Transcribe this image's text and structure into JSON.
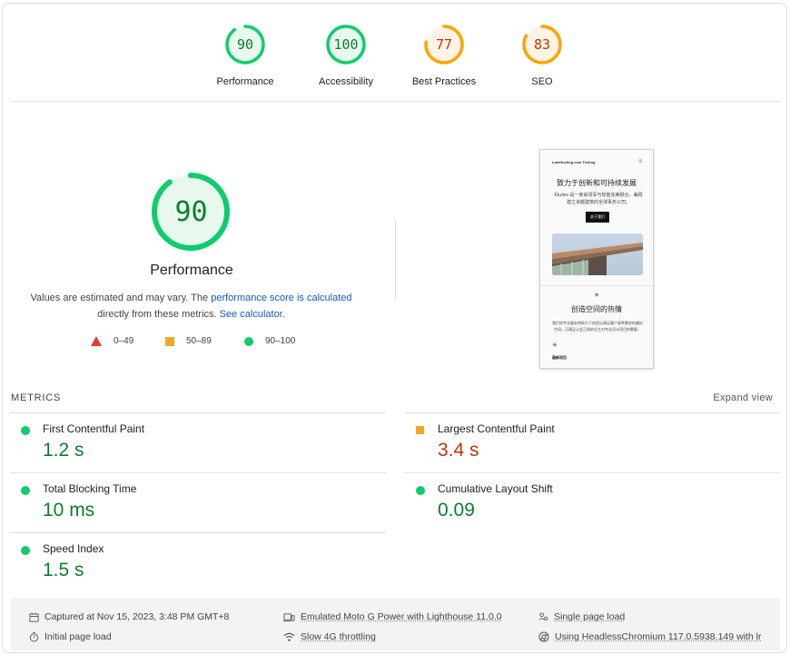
{
  "gauges": [
    {
      "score": "90",
      "label": "Performance",
      "color": "#0cce6b",
      "text_color": "#0a7f2e",
      "bg": "#e8f8ee"
    },
    {
      "score": "100",
      "label": "Accessibility",
      "color": "#0cce6b",
      "text_color": "#0a7f2e",
      "bg": "#e8f8ee"
    },
    {
      "score": "77",
      "label": "Best Practices",
      "color": "#ffa400",
      "text_color": "#c33300",
      "bg": "#fff4e5"
    },
    {
      "score": "83",
      "label": "SEO",
      "color": "#ffa400",
      "text_color": "#c33300",
      "bg": "#fff4e5"
    }
  ],
  "main": {
    "score": "90",
    "title": "Performance",
    "desc_prefix": "Values are estimated and may vary. The ",
    "desc_link1": "performance score is calculated",
    "desc_middle": "directly from these metrics. ",
    "desc_link2": "See calculator",
    "desc_suffix": ".",
    "legend": {
      "fail": "0–49",
      "average": "50–89",
      "pass": "90–100"
    }
  },
  "thumbnail": {
    "site_name": "LateHosting.com Testing",
    "menu_icon": "≡",
    "heading": "致力于创新和可持续发展",
    "paragraph": "Études 是一家由领军与知能完美融合，兼顾建立卓越建筑的全球事务公司。",
    "button": "关于我们",
    "star": "✳",
    "heading2": "创造空间的热情",
    "paragraph2": "我们的专业服务将致力于创造出满足客户各种需求的美好空间，可满足认会正照的业主对专业设计项目的需要。",
    "heading3": "最新项目"
  },
  "metrics": {
    "title": "METRICS",
    "expand_label": "Expand view",
    "items": [
      {
        "name": "First Contentful Paint",
        "value": "1.2 s",
        "status": "pass"
      },
      {
        "name": "Largest Contentful Paint",
        "value": "3.4 s",
        "status": "average"
      },
      {
        "name": "Total Blocking Time",
        "value": "10 ms",
        "status": "pass"
      },
      {
        "name": "Cumulative Layout Shift",
        "value": "0.09",
        "status": "pass"
      },
      {
        "name": "Speed Index",
        "value": "1.5 s",
        "status": "pass"
      }
    ]
  },
  "footer": {
    "captured": "Captured at Nov 15, 2023, 3:48 PM GMT+8",
    "initial_load": "Initial page load",
    "device": "Emulated Moto G Power with Lighthouse 11.0.0",
    "throttling": "Slow 4G throttling",
    "session": "Single page load",
    "browser": "Using HeadlessChromium 117.0.5938.149 with lr"
  }
}
